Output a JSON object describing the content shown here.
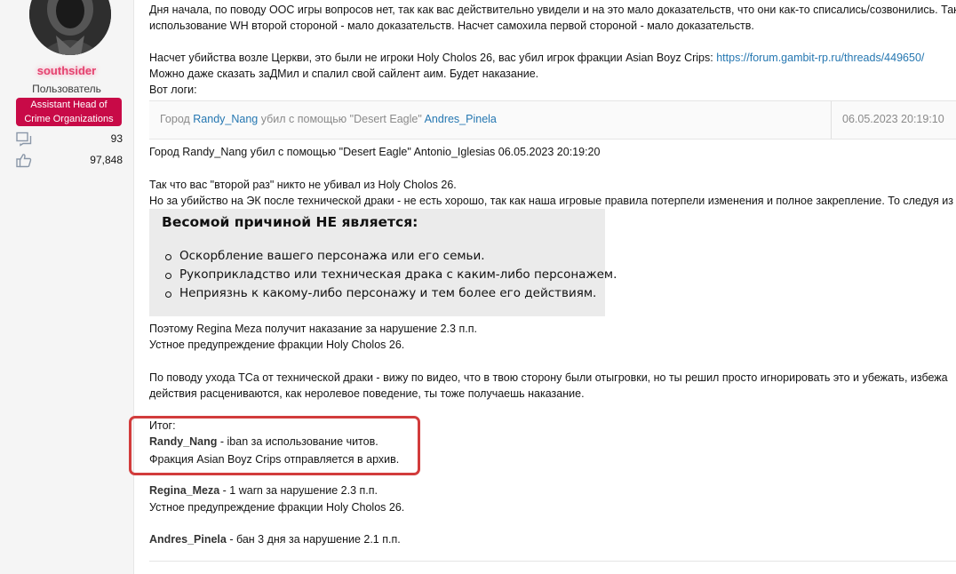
{
  "author": {
    "username": "southsider",
    "user_title": "Пользователь",
    "role_badge_line1": "Assistant Head of",
    "role_badge_line2": "Crime Organizations",
    "messages_count": "93",
    "reactions_count": "97,848",
    "icons": [
      "messages-icon",
      "thumbs-up-icon"
    ]
  },
  "post": {
    "p1_line1": "Дня начала, по поводу ООС игры вопросов нет, так как вас действительно увидели и на это мало доказательств, что они как-то списались/созвонились. Так",
    "p1_line2": "использование WH второй стороной - мало доказательств. Насчет самохила первой стороной - мало доказательств.",
    "p2_line1_text": "Насчет убийства возле Церкви, это были не игроки Holy Cholos 26, вас убил игрок фракции Asian Boyz Crips: ",
    "p2_line1_link": "https://forum.gambit-rp.ru/threads/449650/",
    "p2_line2": "Можно даже сказать заДМил и спалил свой сайлент аим. Будет наказание.",
    "p2_line3": "Вот логи:",
    "log": {
      "prefix": "Город ",
      "killer": "Randy_Nang",
      "middle": " убил с помощью \"Desert Eagle\" ",
      "victim": "Andres_Pinela",
      "date": "06.05.2023 20:19:10"
    },
    "log2": "Город Randy_Nang убил с помощью \"Desert Eagle\" Antonio_Iglesias 06.05.2023 20:19:20",
    "p3_line1": "Так что вас \"второй раз\" никто не убивал из Holy Cholos 26.",
    "p3_line2": "Но за убийство на ЭК после технической драки - не есть хорошо, так как наша игровые правила потерпели изменения и полное закрепление. То следуя из",
    "rules": {
      "title": "Весомой причиной НЕ является:",
      "items": [
        "Оскорбление вашего персонажа или его семьи.",
        "Рукоприкладство или техническая драка с каким-либо персонажем.",
        "Неприязнь к какому-либо персонажу и тем более его действиям."
      ]
    },
    "p4_line1": "Поэтому Regina Meza получит наказание за нарушение 2.3 п.п.",
    "p4_line2": "Устное предупреждение фракции Holy Cholos 26.",
    "p5_line1": "По поводу ухода ТСа от технической драки - вижу по видео, что в твою сторону были отыгровки, но ты решил просто игнорировать это и убежать, избежа",
    "p5_line2": "действия расцениваются, как неролевое поведение, ты тоже получаешь наказание.",
    "summary_label": "Итог:",
    "verdict1_name": "Randy_Nang",
    "verdict1_text": " - iban за использование читов.",
    "verdict1_line2": "Фракция Asian Boyz Crips отправляется в архив.",
    "verdict2_name": "Regina_Meza",
    "verdict2_text": " - 1 warn за нарушение 2.3 п.п.",
    "verdict2_line2": "Устное предупреждение фракции Holy Cholos 26.",
    "verdict3_name": "Andres_Pinela",
    "verdict3_text": " - бан 3 дня за нарушение 2.1 п.п."
  },
  "colors": {
    "username": "#e4426f",
    "badge": "#c80a47",
    "link": "#2577b1",
    "highlight_border": "#d23c3c"
  }
}
